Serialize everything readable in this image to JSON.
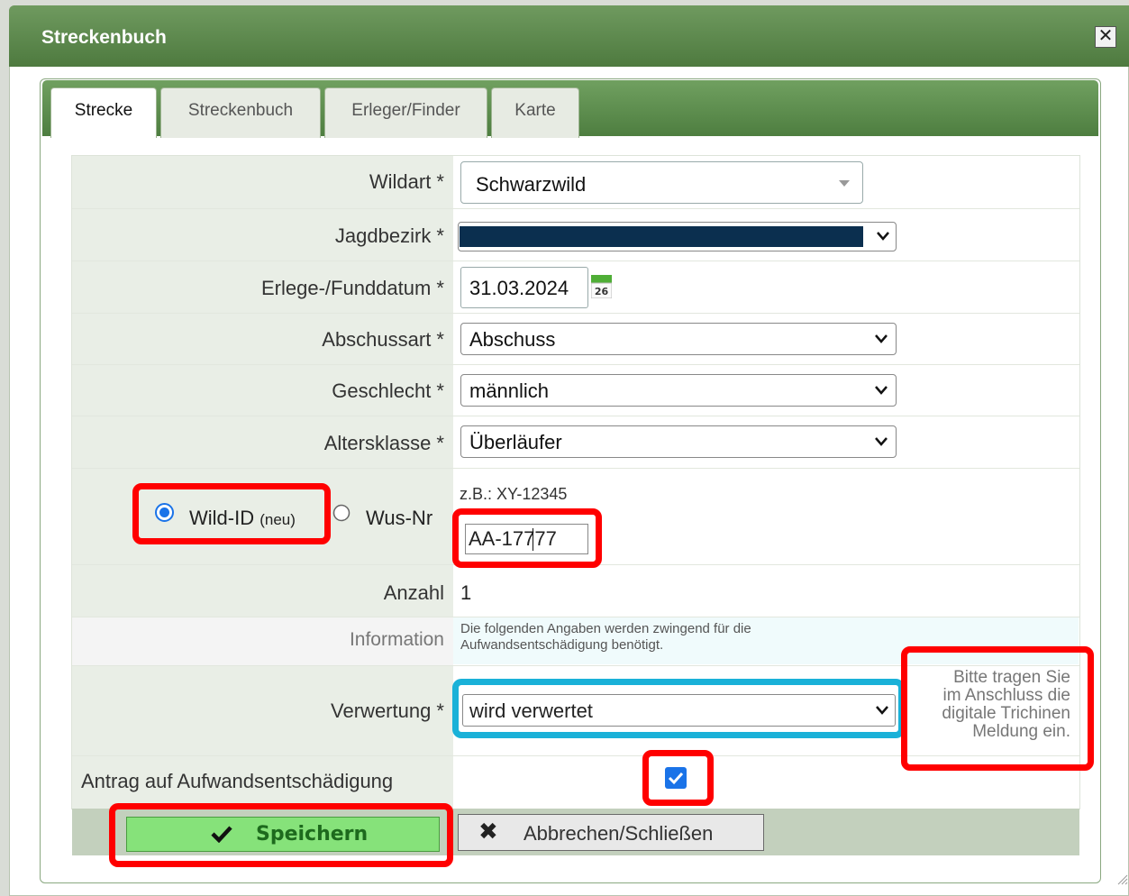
{
  "dialog": {
    "title": "Streckenbuch",
    "close_icon": "close-icon"
  },
  "tabs": [
    {
      "label": "Strecke",
      "active": true
    },
    {
      "label": "Streckenbuch",
      "active": false
    },
    {
      "label": "Erleger/Finder",
      "active": false
    },
    {
      "label": "Karte",
      "active": false
    }
  ],
  "form": {
    "wildart": {
      "label": "Wildart *",
      "value": "Schwarzwild"
    },
    "jagdbezirk": {
      "label": "Jagdbezirk *",
      "value": ""
    },
    "datum": {
      "label": "Erlege-/Funddatum *",
      "value": "31.03.2024",
      "calendar_text": "26"
    },
    "abschussart": {
      "label": "Abschussart *",
      "value": "Abschuss"
    },
    "geschlecht": {
      "label": "Geschlecht *",
      "value": "männlich"
    },
    "altersklasse": {
      "label": "Altersklasse *",
      "value": "Überläufer"
    },
    "id_type": {
      "option_wild_id": "Wild-ID",
      "option_wild_id_note": "(neu)",
      "option_wus_nr": "Wus-Nr",
      "hint": "z.B.: XY-12345",
      "value": "AA-17777"
    },
    "anzahl": {
      "label": "Anzahl",
      "value": "1"
    },
    "information": {
      "label": "Information",
      "text_line1": "Die folgenden Angaben werden zwingend für die",
      "text_line2": "Aufwandsentschädigung benötigt."
    },
    "verwertung": {
      "label": "Verwertung *",
      "value": "wird verwertet",
      "note_line1": "Bitte tragen Sie",
      "note_line2": "im Anschluss die",
      "note_line3": "digitale Trichinen",
      "note_line4": "Meldung ein."
    },
    "antrag": {
      "label": "Antrag auf Aufwandsentschädigung",
      "checked": true
    }
  },
  "buttons": {
    "save_label": "Speichern",
    "cancel_label": "Abbrechen/Schließen"
  },
  "colors": {
    "header_green": "#4e7a3f",
    "save_green": "#86e27a",
    "highlight_red": "#ff0000",
    "highlight_blue": "#1ab1d8",
    "redacted": "#0b2f4f"
  }
}
